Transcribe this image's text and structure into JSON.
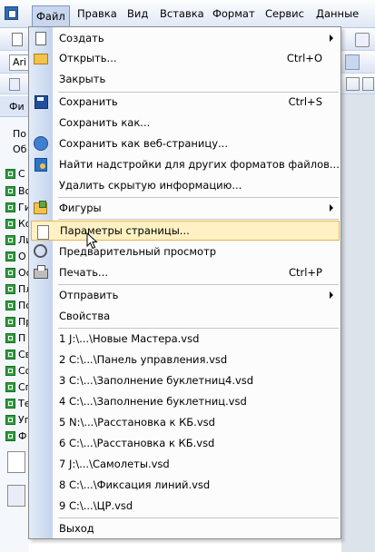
{
  "menubar": {
    "items": [
      "Файл",
      "Правка",
      "Вид",
      "Вставка",
      "Формат",
      "Сервис",
      "Данные"
    ]
  },
  "background": {
    "toolbar_font_fragment": "Ari",
    "panel_title_fragment": "Фи",
    "panel_search_fragment_1": "По",
    "panel_search_fragment_2": "Об",
    "stencils": [
      "С",
      "Во",
      "Ги",
      "Ко",
      "Ли",
      "О",
      "Ос",
      "Пл",
      "По",
      "Пр",
      "П",
      "Св",
      "Со",
      "Сп",
      "Те",
      "Уп",
      "Ф"
    ]
  },
  "file_menu": {
    "items": [
      {
        "label": "Создать",
        "icon": "new-document-icon",
        "submenu": true
      },
      {
        "label": "Открыть...",
        "icon": "open-folder-icon",
        "shortcut": "Ctrl+O"
      },
      {
        "label": "Закрыть"
      },
      {
        "label": "Сохранить",
        "icon": "save-disk-icon",
        "shortcut": "Ctrl+S"
      },
      {
        "label": "Сохранить как..."
      },
      {
        "label": "Сохранить как веб-страницу...",
        "icon": "web-page-icon"
      },
      {
        "label": "Найти надстройки для других форматов файлов...",
        "icon": "find-addins-icon"
      },
      {
        "label": "Удалить скрытую информацию..."
      },
      {
        "label": "Фигуры",
        "icon": "shapes-icon",
        "submenu": true
      },
      {
        "label": "Параметры страницы...",
        "icon": "page-setup-icon",
        "highlighted": true
      },
      {
        "label": "Предварительный просмотр",
        "icon": "print-preview-icon"
      },
      {
        "label": "Печать...",
        "icon": "printer-icon",
        "shortcut": "Ctrl+P"
      },
      {
        "label": "Отправить",
        "submenu": true
      },
      {
        "label": "Свойства"
      },
      {
        "label": "1 J:\\...\\Новые Мастера.vsd"
      },
      {
        "label": "2 C:\\...\\Панель управления.vsd"
      },
      {
        "label": "3 C:\\...\\Заполнение буклетниц4.vsd"
      },
      {
        "label": "4 C:\\...\\Заполнение буклетниц.vsd"
      },
      {
        "label": "5 N:\\...\\Расстановка к КБ.vsd"
      },
      {
        "label": "6 C:\\...\\Расстановка к КБ.vsd"
      },
      {
        "label": "7 J:\\...\\Самолеты.vsd"
      },
      {
        "label": "8 C:\\...\\Фиксация линий.vsd"
      },
      {
        "label": "9 C:\\...\\ЦР.vsd"
      },
      {
        "label": "Выход"
      }
    ]
  },
  "colors": {
    "highlight_fill": "#fff1c3",
    "highlight_border": "#e8b44e",
    "menubar_active": "#c8d6ee",
    "stencil_green": "#2f9e3f"
  }
}
